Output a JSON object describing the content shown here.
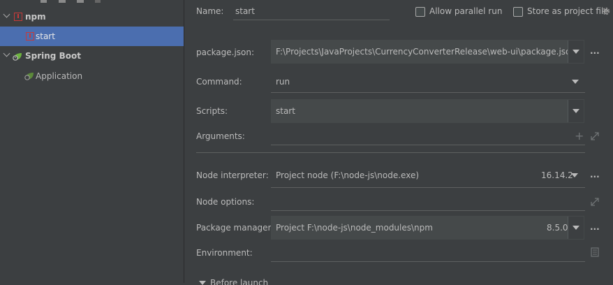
{
  "tree": {
    "items": [
      {
        "label": "npm"
      },
      {
        "label": "start"
      },
      {
        "label": "Spring Boot"
      },
      {
        "label": "Application"
      }
    ]
  },
  "form": {
    "name_label": "Name:",
    "name_value": "start",
    "allow_parallel_label": "Allow parallel run",
    "store_project_label": "Store as project file",
    "package_json_label": "package.json:",
    "package_json_value": "F:\\Projects\\JavaProjects\\CurrencyConverterRelease\\web-ui\\package.json",
    "command_label": "Command:",
    "command_value": "run",
    "scripts_label": "Scripts:",
    "scripts_value": "start",
    "arguments_label": "Arguments:",
    "node_interpreter_label": "Node interpreter:",
    "node_interpreter_value": "Project  node (F:\\node-js\\node.exe)",
    "node_version": "16.14.2",
    "node_options_label": "Node options:",
    "package_manager_label": "Package manager:",
    "package_manager_value": "Project   F:\\node-js\\node_modules\\npm",
    "package_manager_version": "8.5.0",
    "environment_label": "Environment:",
    "before_launch_label": "Before launch"
  }
}
